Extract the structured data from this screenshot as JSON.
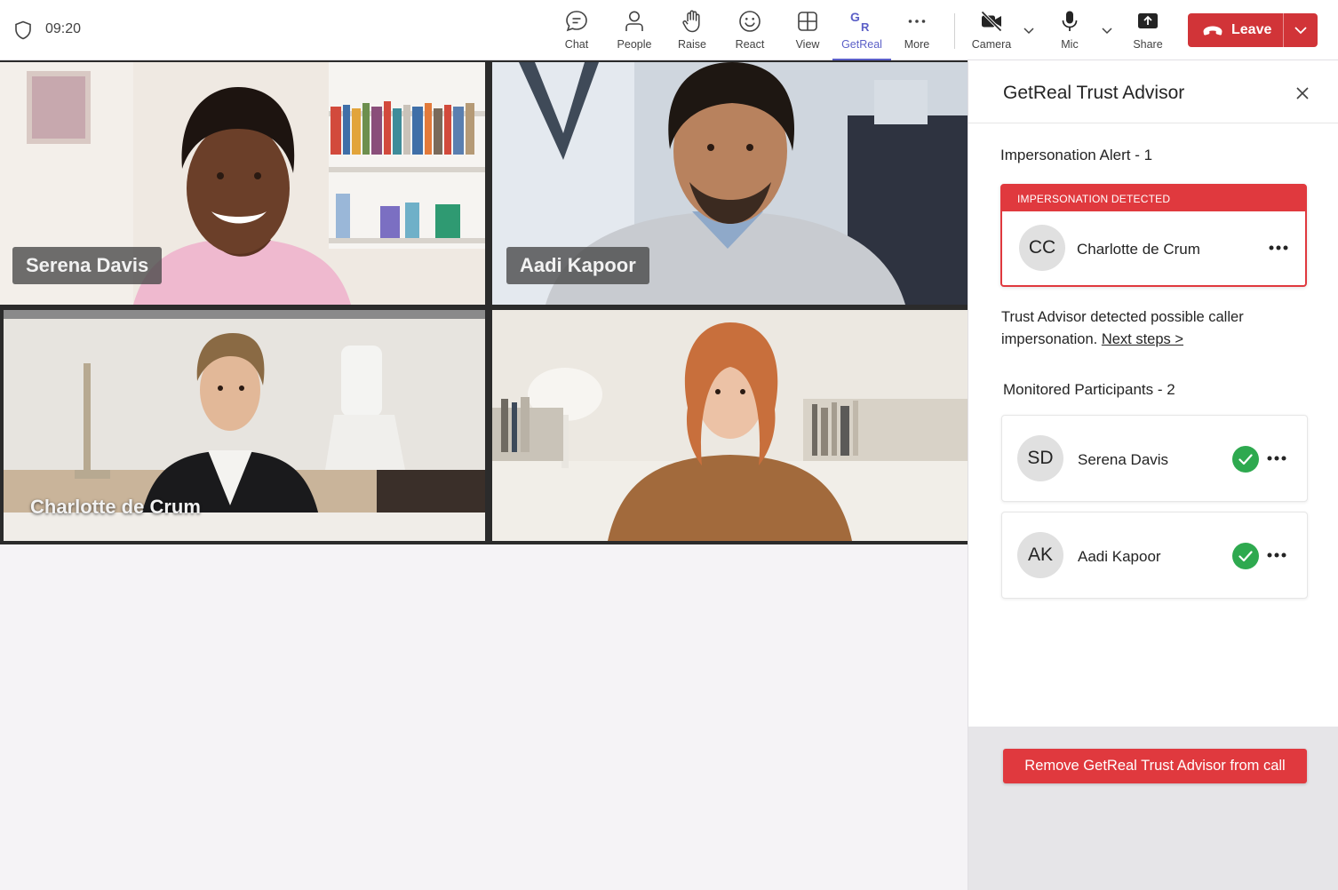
{
  "header": {
    "time": "09:20",
    "toolbar": [
      {
        "id": "chat",
        "label": "Chat",
        "icon": "chat-icon"
      },
      {
        "id": "people",
        "label": "People",
        "icon": "people-icon"
      },
      {
        "id": "raise",
        "label": "Raise",
        "icon": "raise-hand-icon"
      },
      {
        "id": "react",
        "label": "React",
        "icon": "smiley-icon"
      },
      {
        "id": "view",
        "label": "View",
        "icon": "grid-view-icon"
      },
      {
        "id": "getreal",
        "label": "GetReal",
        "icon": "getreal-logo-icon",
        "active": true
      },
      {
        "id": "more",
        "label": "More",
        "icon": "more-dots-icon"
      }
    ],
    "camera_label": "Camera",
    "mic_label": "Mic",
    "share_label": "Share",
    "leave_label": "Leave"
  },
  "video": {
    "tiles": [
      {
        "name": "Serena Davis"
      },
      {
        "name": "Aadi Kapoor"
      },
      {
        "name": "Charlotte de Crum"
      },
      {
        "name": ""
      }
    ]
  },
  "panel": {
    "title": "GetReal Trust Advisor",
    "alert_section_title": "Impersonation Alert - 1",
    "alert": {
      "header": "IMPERSONATION DETECTED",
      "initials": "CC",
      "name": "Charlotte de Crum"
    },
    "description": "Trust Advisor detected possible caller impersonation.",
    "next_steps": "Next steps >",
    "monitored_title": "Monitored Participants - 2",
    "participants": [
      {
        "initials": "SD",
        "name": "Serena Davis",
        "status": "verified"
      },
      {
        "initials": "AK",
        "name": "Aadi Kapoor",
        "status": "verified"
      }
    ],
    "remove_button": "Remove GetReal Trust Advisor from call"
  },
  "colors": {
    "accent": "#5b5fc7",
    "danger": "#d13438",
    "alert_red": "#e0393e",
    "verified_green": "#2ea94f"
  }
}
